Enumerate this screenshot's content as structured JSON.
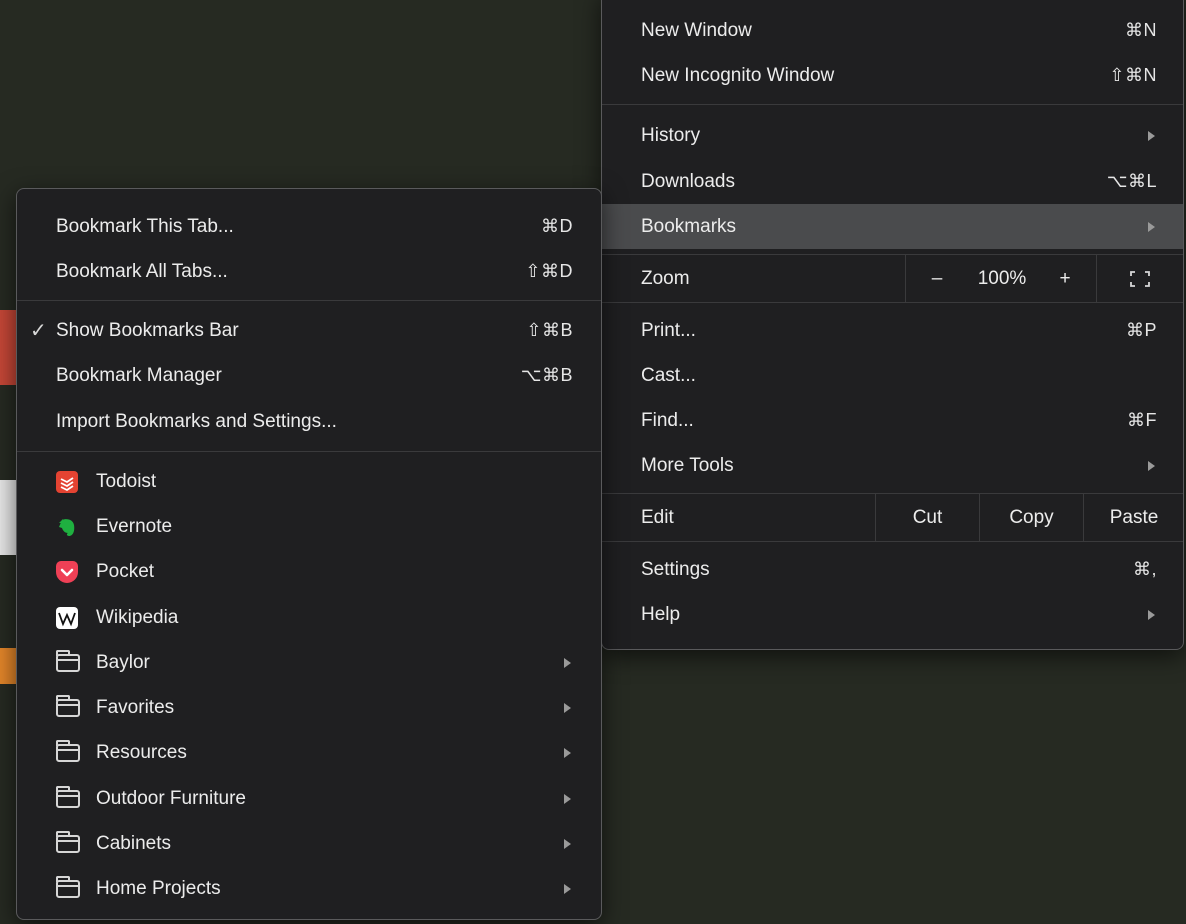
{
  "main_menu": {
    "items": [
      {
        "label": "New Window",
        "shortcut": "⌘N"
      },
      {
        "label": "New Incognito Window",
        "shortcut": "⇧⌘N"
      },
      {
        "label": "History"
      },
      {
        "label": "Downloads",
        "shortcut": "⌥⌘L"
      },
      {
        "label": "Bookmarks"
      },
      {
        "label": "Print...",
        "shortcut": "⌘P"
      },
      {
        "label": "Cast..."
      },
      {
        "label": "Find...",
        "shortcut": "⌘F"
      },
      {
        "label": "More Tools"
      },
      {
        "label": "Settings",
        "shortcut": "⌘,"
      },
      {
        "label": "Help"
      }
    ],
    "zoom": {
      "label": "Zoom",
      "minus": "–",
      "value": "100%",
      "plus": "+"
    },
    "edit": {
      "label": "Edit",
      "cut": "Cut",
      "copy": "Copy",
      "paste": "Paste"
    }
  },
  "bookmarks_menu": {
    "items": [
      {
        "label": "Bookmark This Tab...",
        "shortcut": "⌘D"
      },
      {
        "label": "Bookmark All Tabs...",
        "shortcut": "⇧⌘D"
      },
      {
        "label": "Show Bookmarks Bar",
        "shortcut": "⇧⌘B",
        "check": "✓"
      },
      {
        "label": "Bookmark Manager",
        "shortcut": "⌥⌘B"
      },
      {
        "label": "Import Bookmarks and Settings..."
      }
    ],
    "sites": [
      {
        "label": "Todoist",
        "icon": "todoist-icon",
        "color": "#e44332"
      },
      {
        "label": "Evernote",
        "icon": "evernote-icon",
        "color": "#1fb040"
      },
      {
        "label": "Pocket",
        "icon": "pocket-icon",
        "color": "#ef4056"
      },
      {
        "label": "Wikipedia",
        "icon": "wikipedia-icon",
        "color": "#ffffff"
      }
    ],
    "folders": [
      {
        "label": "Baylor"
      },
      {
        "label": "Favorites"
      },
      {
        "label": "Resources"
      },
      {
        "label": "Outdoor Furniture"
      },
      {
        "label": "Cabinets"
      },
      {
        "label": "Home Projects"
      }
    ]
  }
}
